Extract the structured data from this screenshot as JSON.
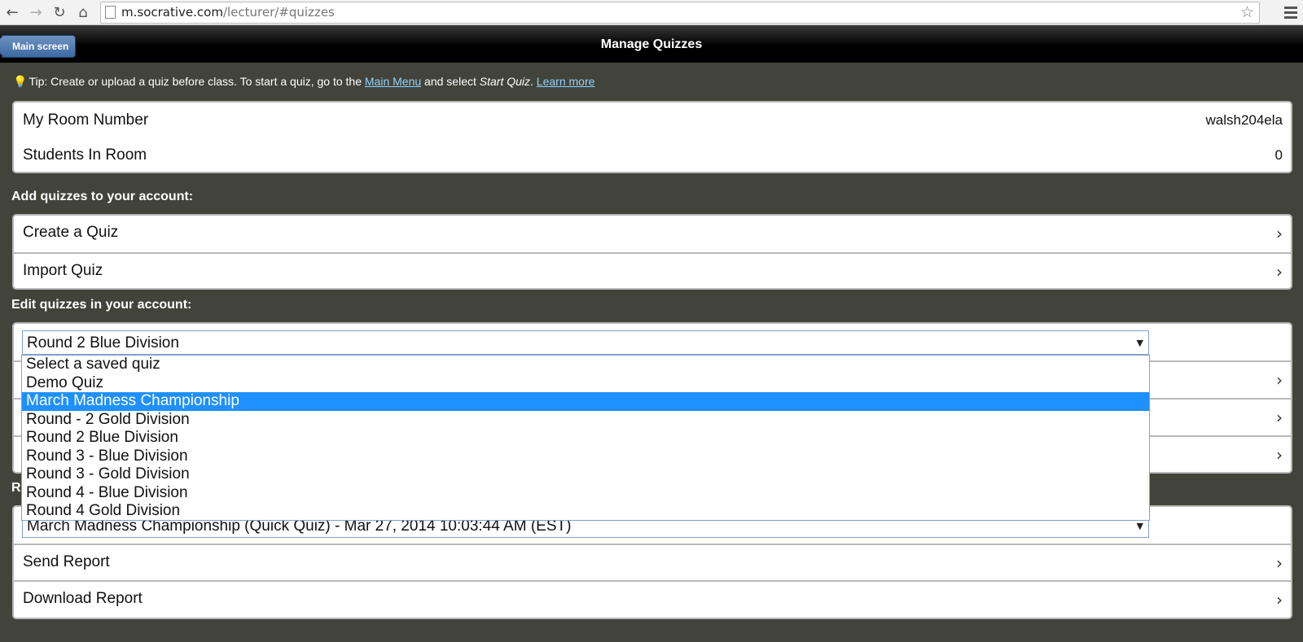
{
  "browser": {
    "url_host": "m.socrative.com",
    "url_path": "/lecturer/#quizzes",
    "icons": [
      "back-icon",
      "forward-icon",
      "reload-icon",
      "home-icon",
      "bookmark-star-icon",
      "menu-icon"
    ]
  },
  "header": {
    "back_label": "Main screen",
    "title": "Manage Quizzes"
  },
  "tip": {
    "prefix": "Tip: Create or upload a quiz before class. To start a quiz, go to the ",
    "main_menu_link": "Main Menu",
    "middle": " and select ",
    "start_quiz": "Start Quiz",
    "period": ". ",
    "learn_more_link": "Learn more"
  },
  "room": {
    "room_number_label": "My Room Number",
    "room_number_value": "walsh204ela",
    "students_label": "Students In Room",
    "students_value": "0"
  },
  "add_section": {
    "label": "Add quizzes to your account:",
    "create": "Create a Quiz",
    "import": "Import Quiz"
  },
  "edit_section": {
    "label": "Edit quizzes in your account:",
    "selected": "Round 2 Blue Division",
    "options": [
      "Select a saved quiz",
      "Demo Quiz",
      "March Madness Championship",
      "Round - 2 Gold Division",
      "Round 2 Blue Division",
      "Round 3 - Blue Division",
      "Round 3 - Gold Division",
      "Round 4 - Blue Division",
      "Round 4 Gold Division"
    ],
    "highlighted_option": "March Madness Championship"
  },
  "report_section": {
    "label_fragment": "R",
    "selected": "March Madness Championship (Quick Quiz) - Mar 27, 2014 10:03:44 AM (EST)",
    "send": "Send Report",
    "download": "Download Report"
  }
}
